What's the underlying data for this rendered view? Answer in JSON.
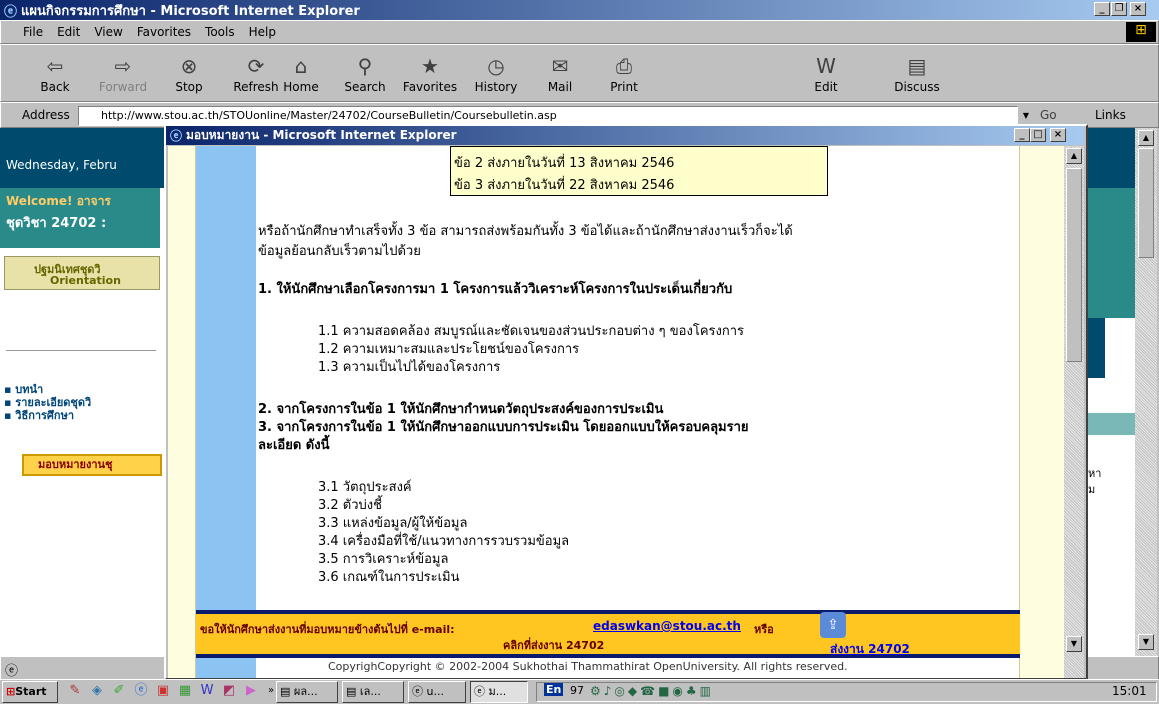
{
  "main_window": {
    "title": "แผนกิจกรรมการศึกษา - Microsoft Internet Explorer",
    "menu": [
      "File",
      "Edit",
      "View",
      "Favorites",
      "Tools",
      "Help"
    ],
    "toolbar": [
      "Back",
      "Forward",
      "Stop",
      "Refresh",
      "Home",
      "Search",
      "Favorites",
      "History",
      "Mail",
      "Print",
      "Edit",
      "Discuss"
    ],
    "address_label": "Address",
    "address_value": "http://www.stou.ac.th/STOUonline/Master/24702/CourseBulletin/Coursebulletin.asp",
    "go_label": "Go",
    "links_label": "Links"
  },
  "background_page": {
    "date": "Wednesday, Febru",
    "welcome": "Welcome! อาจาร",
    "course": "ชุดวิชา 24702 :",
    "orientation_th": "ปฐมนิเทศชุดวิ",
    "orientation_en": "Orientation",
    "nav": [
      "บทนำ",
      "รายละเอียดชุดวิ",
      "วิธีการศึกษา"
    ],
    "assign_button": "มอบหมายงานชุ",
    "right_text1": "หา",
    "right_text2": "ม"
  },
  "popup": {
    "title": "มอบหมายงาน - Microsoft Internet Explorer",
    "box_lines": [
      "ข้อ 2 ส่งภายในวันที่ 13 สิงหาคม 2546",
      "ข้อ 3 ส่งภายในวันที่ 22 สิงหาคม 2546"
    ],
    "para1": "หรือถ้านักศึกษาทำเสร็จทั้ง 3 ข้อ สามารถส่งพร้อมกันทั้ง 3 ข้อได้และถ้านักศึกษาส่งงานเร็วก็จะได้",
    "para2": "ข้อมูลย้อนกลับเร็วตามไปด้วย",
    "q1": "1. ให้นักศึกษาเลือกโครงการมา 1 โครงการแล้ววิเคราะห์โครงการในประเด็นเกี่ยวกับ",
    "q1_items": [
      "1.1 ความสอดคล้อง สมบูรณ์และชัดเจนของส่วนประกอบต่าง ๆ ของโครงการ",
      "1.2 ความเหมาะสมและประโยชน์ของโครงการ",
      "1.3 ความเป็นไปได้ของโครงการ"
    ],
    "q2": "2. จากโครงการในข้อ 1 ให้นักศึกษากำหนดวัตถุประสงค์ของการประเมิน",
    "q3a": "3. จากโครงการในข้อ 1 ให้นักศึกษาออกแบบการประเมิน โดยออกแบบให้ครอบคลุมราย",
    "q3b": "ละเอียด ดังนี้",
    "q3_items": [
      "3.1 วัตถุประสงค์",
      "3.2 ตัวบ่งชี้",
      "3.3 แหล่งข้อมูล/ผู้ให้ข้อมูล",
      "3.4 เครื่องมือที่ใช้/แนวทางการรวบรวมข้อมูล",
      "3.5 การวิเคราะห์ข้อมูล",
      "3.6 เกณฑ์ในการประเมิน"
    ],
    "banner_text1": "ขอให้นักศึกษาส่งงานที่มอบหมายข้างต้นไปที่ e-mail:",
    "banner_email": "edaswkan@stou.ac.th",
    "banner_text2": "หรือ",
    "banner_text3": "คลิกที่ส่งงาน 24702",
    "banner_link": "ส่งงาน 24702",
    "copyright": "CopyrighCopyright © 2002-2004 Sukhothai Thammathirat OpenUniversity. All rights reserved."
  },
  "taskbar": {
    "start": "Start",
    "tasks": [
      "ผล...",
      "เล...",
      "u...",
      "ม..."
    ],
    "tray_lang": "En",
    "tray_num": "97",
    "clock": "15:01"
  }
}
